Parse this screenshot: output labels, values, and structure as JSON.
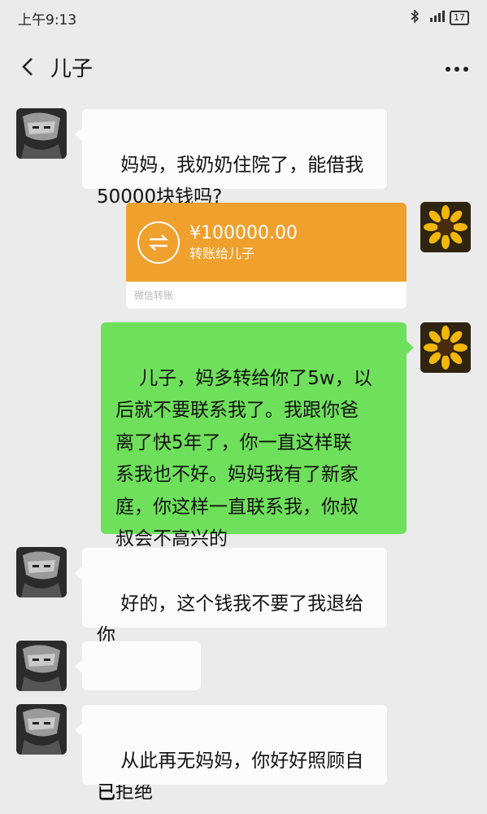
{
  "status": {
    "time": "上午9:13",
    "signal": "4G",
    "battery": "17"
  },
  "header": {
    "title": "儿子"
  },
  "messages": [
    {
      "sender": "son",
      "type": "text",
      "text": "妈妈，我奶奶住院了，能借我\n50000块钱吗?"
    },
    {
      "sender": "mom",
      "type": "transfer",
      "amount": "¥100000.00",
      "note": "转账给儿子",
      "footer": "微信转账"
    },
    {
      "sender": "mom",
      "type": "text",
      "text": "儿子，妈多转给你了5w，以\n后就不要联系我了。我跟你爸\n离了快5年了，你一直这样联\n系我也不好。妈妈我有了新家\n庭，你这样一直联系我，你叔\n叔会不高兴的"
    },
    {
      "sender": "son",
      "type": "text",
      "text": "好的，这个钱我不要了我退给\n你"
    },
    {
      "sender": "son",
      "type": "call",
      "text": "已拒绝"
    },
    {
      "sender": "son",
      "type": "text",
      "text": "从此再无妈妈，你好好照顾自\n己"
    }
  ],
  "colors": {
    "background": "#ebebeb",
    "green_bubble": "#6fe05b",
    "transfer_orange": "#f0a02d"
  }
}
